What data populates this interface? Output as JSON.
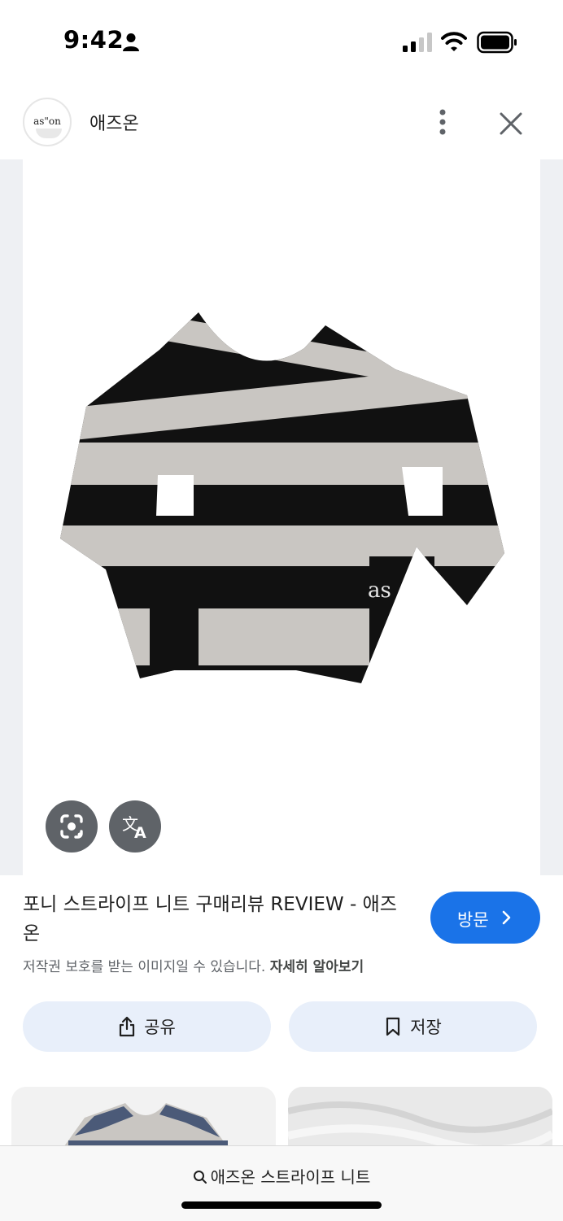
{
  "status_bar": {
    "time": "9:42"
  },
  "header": {
    "site_name": "애즈온",
    "logo_text": "as\"on"
  },
  "image_overlay": {
    "lens_icon": "google-lens-icon",
    "translate_icon": "translate-icon"
  },
  "result": {
    "title": "포니 스트라이프 니트 구매리뷰 REVIEW - 애즈온",
    "copyright_text": "저작권 보호를 받는 이미지일 수 있습니다.",
    "learn_more": "자세히 알아보기",
    "visit_label": "방문"
  },
  "actions": {
    "share_label": "공유",
    "save_label": "저장"
  },
  "bottom_bar": {
    "search_query": "애즈온 스트라이프 니트"
  },
  "colors": {
    "accent": "#1a73e8",
    "chip": "#e8effa",
    "overlay_button": "#5f6368"
  }
}
